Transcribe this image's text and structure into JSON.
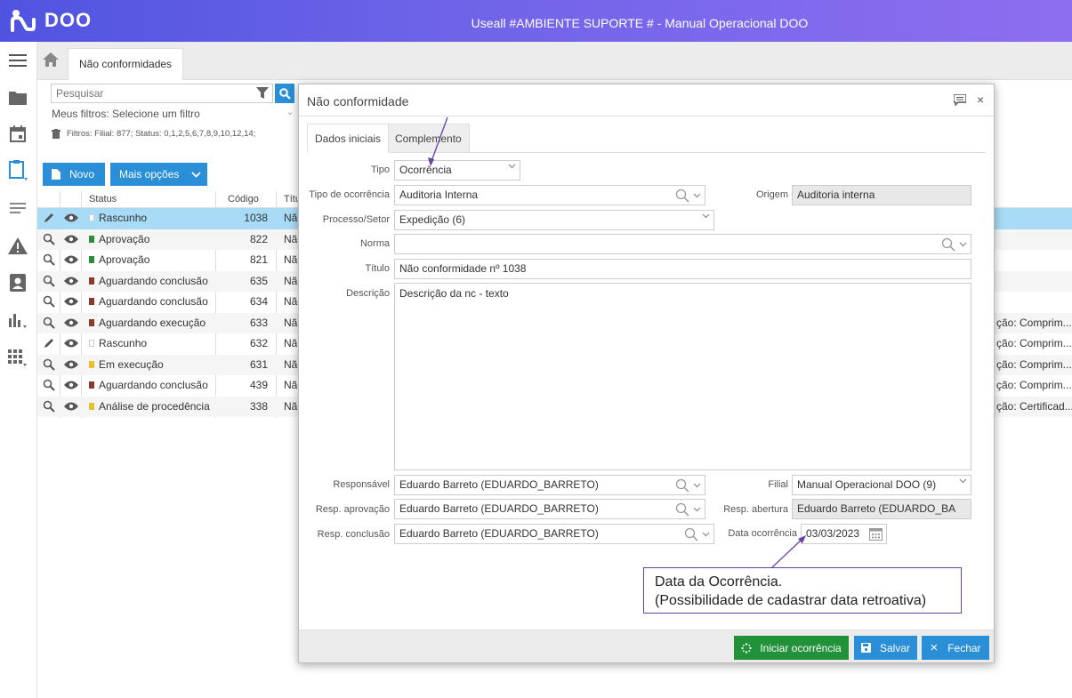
{
  "header": {
    "logo_text": "DOO",
    "title": "Useall #AMBIENTE SUPORTE # - Manual Operacional DOO"
  },
  "rail": {
    "icons": [
      "menu-icon",
      "folder-icon",
      "calendar-icon",
      "clipboard-icon",
      "list-icon",
      "warning-icon",
      "contact-icon",
      "chart-icon",
      "apps-icon"
    ]
  },
  "tabs": {
    "active_label": "Não conformidades"
  },
  "list": {
    "search_placeholder": "Pesquisar",
    "my_filters_label": "Meus filtros:",
    "my_filters_value": "Selecione um filtro",
    "filters_info": "Filtros: Filial: 877; Status: 0,1,2,5,6,7,8,9,10,12,14;",
    "new_button": "Novo",
    "more_options_button": "Mais opções",
    "columns": {
      "status": "Status",
      "code": "Código",
      "title": "Títu"
    },
    "rows": [
      {
        "icon": "edit",
        "status": "Rascunho",
        "color": "#ffffff",
        "code": "1038",
        "title": "Não",
        "extra": ""
      },
      {
        "icon": "search",
        "status": "Aprovação",
        "color": "#2e8b3a",
        "code": "822",
        "title": "Não",
        "extra": ""
      },
      {
        "icon": "search",
        "status": "Aprovação",
        "color": "#2e8b3a",
        "code": "821",
        "title": "Não",
        "extra": ""
      },
      {
        "icon": "search",
        "status": "Aguardando conclusão",
        "color": "#8b3a2e",
        "code": "635",
        "title": "Não",
        "extra": ""
      },
      {
        "icon": "search",
        "status": "Aguardando conclusão",
        "color": "#8b3a2e",
        "code": "634",
        "title": "Não",
        "extra": ""
      },
      {
        "icon": "search",
        "status": "Aguardando execução",
        "color": "#8b3a2e",
        "code": "633",
        "title": "Não",
        "extra": "ção: Comprim..."
      },
      {
        "icon": "edit",
        "status": "Rascunho",
        "color": "#ffffff",
        "code": "632",
        "title": "Não",
        "extra": "ção: Comprim..."
      },
      {
        "icon": "search",
        "status": "Em execução",
        "color": "#e8c030",
        "code": "631",
        "title": "Não",
        "extra": "ção: Comprim..."
      },
      {
        "icon": "search",
        "status": "Aguardando conclusão",
        "color": "#8b3a2e",
        "code": "439",
        "title": "Não",
        "extra": "ção: Comprim..."
      },
      {
        "icon": "search",
        "status": "Análise de procedência",
        "color": "#e8c030",
        "code": "338",
        "title": "Não",
        "extra": "ção: Certificad..."
      }
    ]
  },
  "modal": {
    "title": "Não conformidade",
    "tab_main": "Dados iniciais",
    "tab_extra": "Complemento",
    "labels": {
      "tipo": "Tipo",
      "tipo_ocorrencia": "Tipo de ocorrência",
      "origem": "Origem",
      "processo": "Processo/Setor",
      "norma": "Norma",
      "titulo": "Título",
      "descricao": "Descrição",
      "responsavel": "Responsável",
      "filial": "Filial",
      "resp_aprovacao": "Resp. aprovação",
      "resp_abertura": "Resp. abertura",
      "resp_conclusao": "Resp. conclusão",
      "data_ocorrencia": "Data ocorrência"
    },
    "values": {
      "tipo": "Ocorrência",
      "tipo_ocorrencia": "Auditoria Interna",
      "origem": "Auditoria interna",
      "processo": "Expedição (6)",
      "norma": "",
      "titulo": "Não conformidade nº 1038",
      "descricao": "Descrição da nc - texto",
      "responsavel": "Eduardo Barreto  (EDUARDO_BARRETO)",
      "filial": "Manual Operacional DOO (9)",
      "resp_aprovacao": "Eduardo Barreto  (EDUARDO_BARRETO)",
      "resp_abertura": "Eduardo Barreto  (EDUARDO_BA",
      "resp_conclusao": "Eduardo Barreto  (EDUARDO_BARRETO)",
      "data_ocorrencia": "03/03/2023"
    },
    "buttons": {
      "start": "Iniciar ocorrência",
      "save": "Salvar",
      "close": "Fechar"
    }
  },
  "annotation": {
    "line1": "Data da Ocorrência.",
    "line2": "(Possibilidade de cadastrar data retroativa)"
  },
  "colors": {
    "accent": "#2a8fd6",
    "success": "#21913a",
    "annotation": "#6b3fa0",
    "selected_row": "#a8dcf6"
  }
}
